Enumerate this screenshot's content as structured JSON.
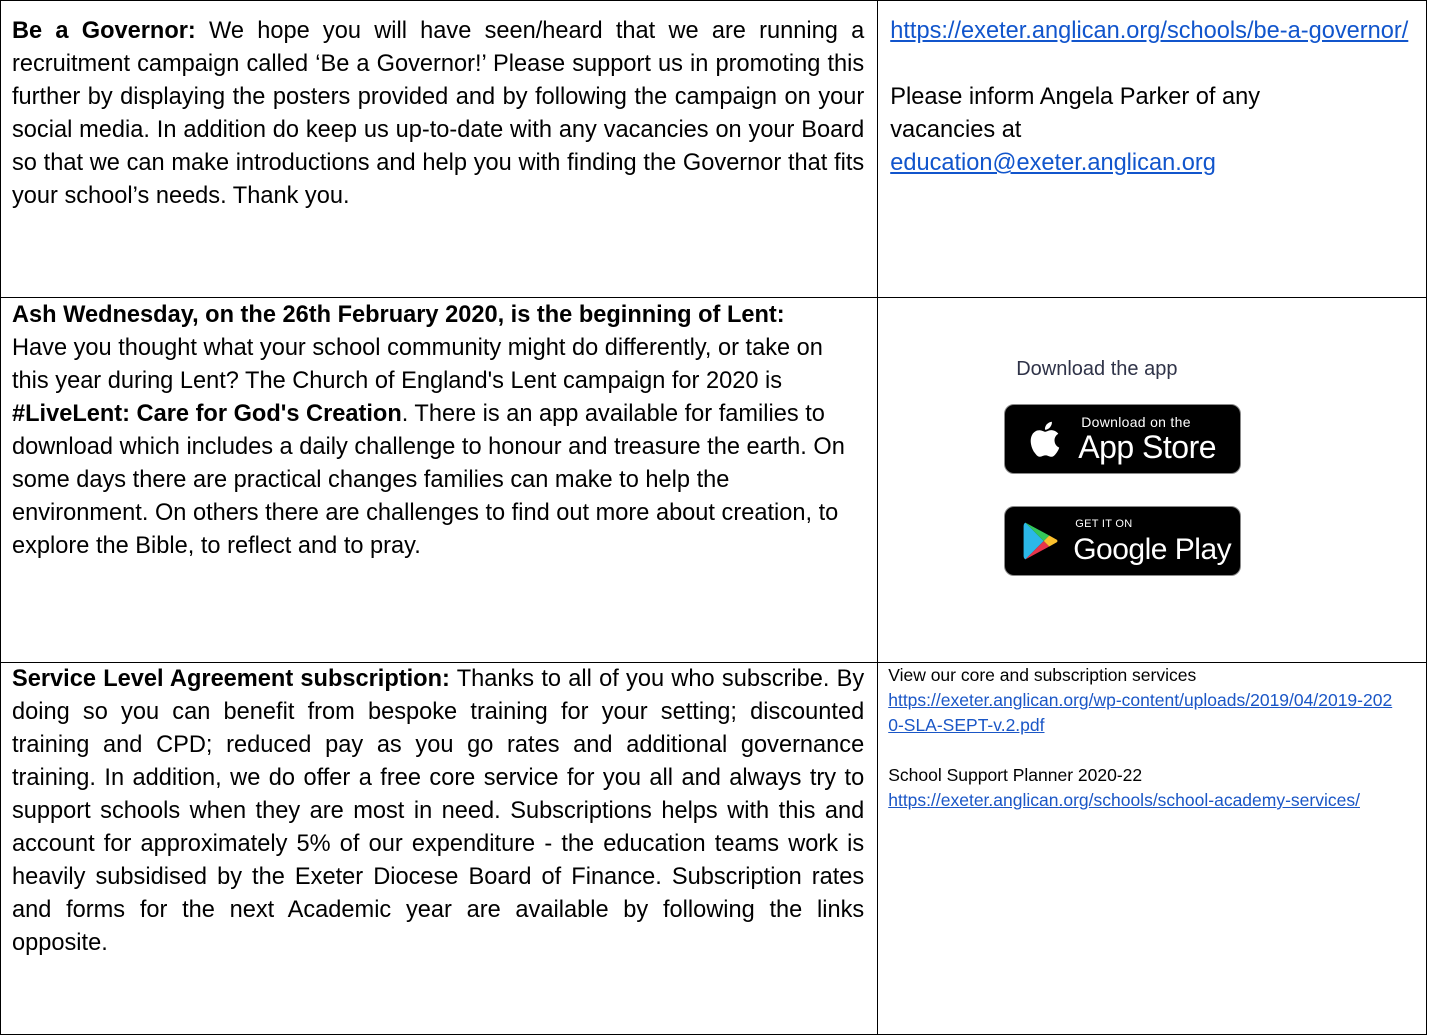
{
  "rows": [
    {
      "left": {
        "heading": "Be a Governor:",
        "text": " We hope you will have seen/heard that we are running a recruitment campaign called ‘Be a Governor!’  Please support us in promoting this further by displaying the posters provided and by following the campaign on your social media.  In addition do keep us up-to-date with any vacancies on your Board so that we can make introductions and help you with finding the Governor that fits your school’s needs. Thank you."
      },
      "right": {
        "link": "https://exeter.anglican.org/schools/be-a-governor/",
        "text": "Please inform Angela Parker of any vacancies at",
        "email": "education@exeter.anglican.org"
      }
    },
    {
      "left": {
        "heading": "Ash Wednesday, on the 26th February 2020, is the beginning of Lent:",
        "text_a": "Have you thought what your school community might do differently, or take on this year during Lent?  The Church of England's Lent campaign for 2020 is ",
        "campaign": "#LiveLent: Care for God's Creation",
        "text_b": ".  There is an app available for families to download which includes a daily challenge to honour and treasure the earth. On some days there are practical changes families can make to help the environment. On others there are challenges to find out more about creation, to explore the Bible, to reflect and to pray."
      },
      "right": {
        "download_title": "Download the app",
        "app_store": {
          "top": "Download on the",
          "big": "App Store",
          "icon": "apple-icon"
        },
        "google_play": {
          "top": "GET IT ON",
          "big": "Google Play",
          "icon": "google-play-icon"
        }
      }
    },
    {
      "left": {
        "heading": "Service Level Agreement subscription:",
        "text": "  Thanks to all of you who subscribe.  By doing so you can benefit from bespoke training for your setting; discounted training and CPD; reduced pay as you go rates and additional governance training.  In addition, we do offer a free core service for you all and always try to support schools when they are most in need.  Subscriptions helps with this and account for approximately 5% of our expenditure - the education teams work is heavily subsidised by the Exeter Diocese Board of Finance.  Subscription rates and forms for the next Academic year are available by following the links opposite."
      },
      "right": {
        "label_1": "View our core and subscription services",
        "link_1": "https://exeter.anglican.org/wp-content/uploads/2019/04/2019-2020-SLA-SEPT-v.2.pdf",
        "label_2": "School Support Planner 2020-22",
        "link_2": "https://exeter.anglican.org/schools/school-academy-services/"
      }
    }
  ],
  "colors": {
    "link": "#1155cc",
    "border": "#000000"
  }
}
